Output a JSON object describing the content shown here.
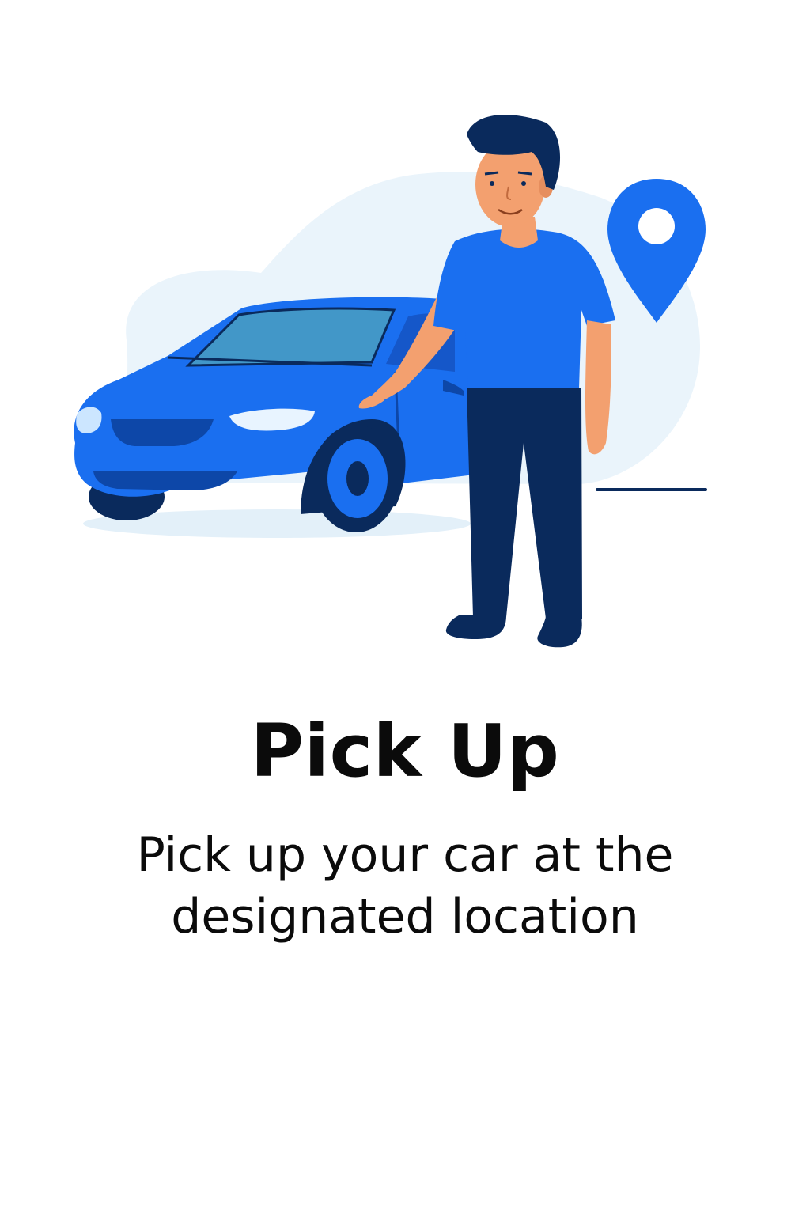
{
  "onboarding": {
    "title": "Pick Up",
    "description": "Pick up your car at the designated location"
  },
  "illustration": {
    "subject": "person-with-car",
    "icons": [
      "location-pin-icon"
    ]
  },
  "colors": {
    "primary_blue": "#1a6ff0",
    "navy": "#0a2a5c",
    "light_blob": "#eaf4fb",
    "text": "#0b0b0b",
    "background": "#ffffff"
  }
}
